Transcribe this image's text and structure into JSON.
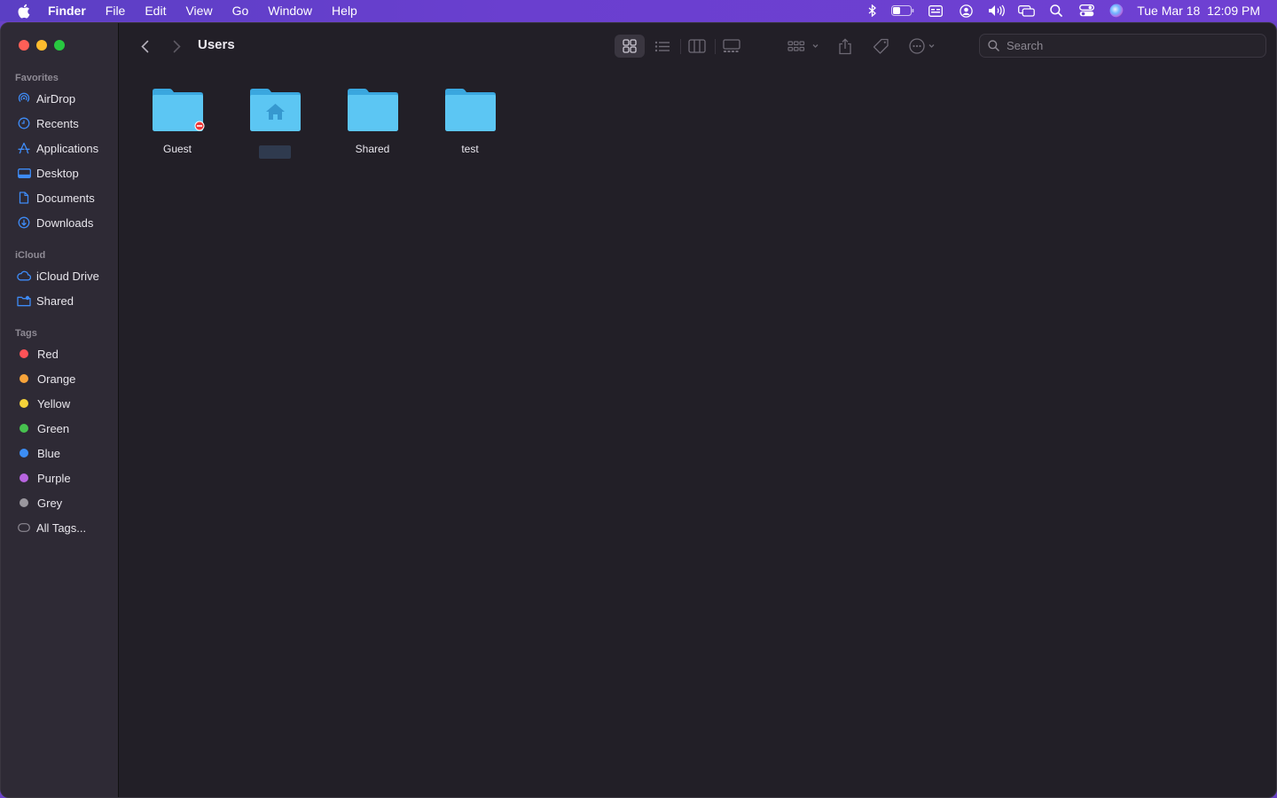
{
  "menubar": {
    "app_name": "Finder",
    "menus": [
      "File",
      "Edit",
      "View",
      "Go",
      "Window",
      "Help"
    ],
    "status_icons": [
      "bluetooth-icon",
      "battery-icon",
      "keyboard-input-icon",
      "user-account-icon",
      "volume-icon",
      "screen-mirroring-icon",
      "spotlight-search-icon",
      "control-center-icon",
      "siri-icon"
    ],
    "clock": "Tue Mar 18  12:09 PM"
  },
  "sidebar": {
    "favorites_title": "Favorites",
    "favorites": [
      {
        "label": "AirDrop",
        "icon": "airdrop-icon"
      },
      {
        "label": "Recents",
        "icon": "clock-icon"
      },
      {
        "label": "Applications",
        "icon": "applications-icon"
      },
      {
        "label": "Desktop",
        "icon": "desktop-icon"
      },
      {
        "label": "Documents",
        "icon": "document-icon"
      },
      {
        "label": "Downloads",
        "icon": "download-icon"
      }
    ],
    "icloud_title": "iCloud",
    "icloud": [
      {
        "label": "iCloud Drive",
        "icon": "cloud-icon"
      },
      {
        "label": "Shared",
        "icon": "shared-folder-icon"
      }
    ],
    "tags_title": "Tags",
    "tags": [
      {
        "label": "Red",
        "color": "#ff5257"
      },
      {
        "label": "Orange",
        "color": "#f7a33a"
      },
      {
        "label": "Yellow",
        "color": "#f5d33a"
      },
      {
        "label": "Green",
        "color": "#47c24f"
      },
      {
        "label": "Blue",
        "color": "#3c8ef5"
      },
      {
        "label": "Purple",
        "color": "#b865e0"
      },
      {
        "label": "Grey",
        "color": "#9a979e"
      },
      {
        "label": "All Tags...",
        "color": ""
      }
    ]
  },
  "toolbar": {
    "title": "Users",
    "search_placeholder": "Search",
    "active_view": "icon"
  },
  "files": [
    {
      "label": "Guest",
      "kind": "guest-folder"
    },
    {
      "label": "",
      "kind": "home-folder"
    },
    {
      "label": "Shared",
      "kind": "folder"
    },
    {
      "label": "test",
      "kind": "folder"
    }
  ],
  "colors": {
    "accent": "#3e8bf6",
    "folder": "#58c4f2"
  }
}
